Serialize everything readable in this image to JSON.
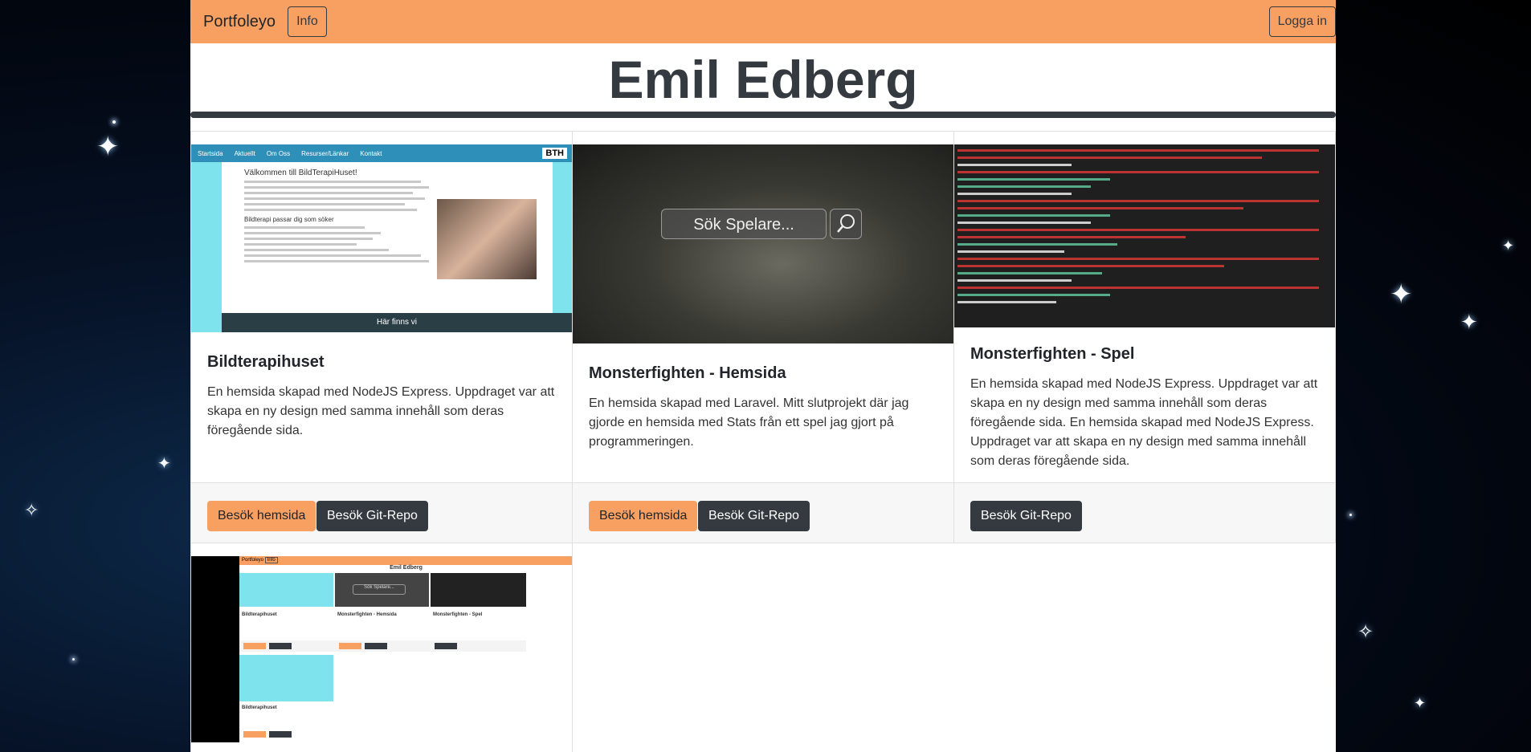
{
  "navbar": {
    "brand": "Portfoleyo",
    "info_label": "Info",
    "login_label": "Logga in"
  },
  "page_title": "Emil Edberg",
  "colors": {
    "accent": "#f8a062",
    "dark": "#343a40"
  },
  "cards": [
    {
      "title": "Bildterapihuset",
      "text": "En hemsida skapad med NodeJS Express. Uppdraget var att skapa en ny design med samma innehåll som deras föregående sida.",
      "visit_label": "Besök hemsida",
      "repo_label": "Besök Git-Repo",
      "thumb": {
        "nav": [
          "Startsida",
          "Aktuellt",
          "Om Oss",
          "Resurser/Länkar",
          "Kontakt"
        ],
        "logo": "BTH",
        "heading": "Välkommen till BildTerapiHuset!",
        "subheading": "Bildterapi passar dig som söker",
        "footer": "Här finns vi"
      }
    },
    {
      "title": "Monsterfighten - Hemsida",
      "text": "En hemsida skapad med Laravel. Mitt slutprojekt där jag gjorde en hemsida med Stats från ett spel jag gjort på programmeringen.",
      "visit_label": "Besök hemsida",
      "repo_label": "Besök Git-Repo",
      "thumb": {
        "search_placeholder": "Sök Spelare..."
      }
    },
    {
      "title": "Monsterfighten - Spel",
      "text": "En hemsida skapad med NodeJS Express. Uppdraget var att skapa en ny design med samma innehåll som deras föregående sida. En hemsida skapad med NodeJS Express. Uppdraget var att skapa en ny design med samma innehåll som deras föregående sida.",
      "repo_label": "Besök Git-Repo"
    },
    {
      "thumb": {
        "brand": "Portfoleyo",
        "info": "Info",
        "title": "Emil Edberg",
        "search": "Sök Spelare...",
        "card_titles": [
          "Bildterapihuset",
          "Monsterfighten - Hemsida",
          "Monsterfighten - Spel",
          "Bildterapihuset"
        ]
      }
    }
  ]
}
